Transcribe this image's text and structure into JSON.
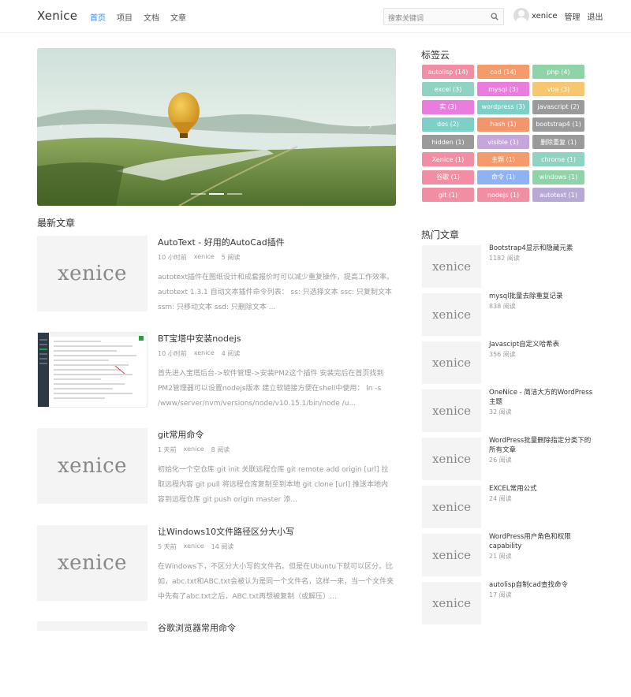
{
  "header": {
    "brand": "Xenice",
    "nav": [
      "首页",
      "项目",
      "文档",
      "文章"
    ],
    "search_placeholder": "搜索关键词",
    "username": "xenice",
    "manage_label": "管理",
    "logout_label": "退出"
  },
  "sections": {
    "latest_title": "最新文章",
    "tags_title": "标签云",
    "hot_title": "热门文章"
  },
  "posts": [
    {
      "title": "AutoText - 好用的AutoCad插件",
      "time": "10 小时前",
      "author": "xenice",
      "reads": "5 阅读",
      "thumb_text": "xenice",
      "excerpt": "autotext插件在图纸设计和成套报价时可以减少重复操作，提高工作效率。 autotext 1.3.1 自动文本插件命令列表： ss: 只选择文本 ssc: 只复制文本 ssm: 只移动文本 ssd: 只删除文本 ..."
    },
    {
      "title": "BT宝塔中安装nodejs",
      "time": "10 小时前",
      "author": "xenice",
      "reads": "4 阅读",
      "thumb_text": "",
      "excerpt": "首先进入宝塔后台->软件管理->安装PM2这个插件 安装完后在首页找到PM2管理器可以设置nodejs版本 建立软链接方便在shell中使用： ln -s /www/server/nvm/versions/node/v10.15.1/bin/node /u..."
    },
    {
      "title": "git常用命令",
      "time": "1 天前",
      "author": "xenice",
      "reads": "8 阅读",
      "thumb_text": "xenice",
      "excerpt": "初始化一个空仓库 git init 关联远程仓库 git remote add origin [url] 拉取远程内容 git pull 将远程仓库复制至到本地 git clone [url] 推送本地内容到远程仓库 git push origin master 添..."
    },
    {
      "title": "让Windows10文件路径区分大小写",
      "time": "5 天前",
      "author": "xenice",
      "reads": "14 阅读",
      "thumb_text": "xenice",
      "excerpt": "在Windows下，不区分大小写的文件名。但是在Ubuntu下就可以区分。比如，abc.txt和ABC.txt会被认为是同一个文件名，这样一来，当一个文件夹中先有了abc.txt之后，ABC.txt再想被复制（或解压）..."
    },
    {
      "title": "谷歌浏览器常用命令",
      "time": "",
      "author": "",
      "reads": "",
      "thumb_text": "",
      "excerpt": ""
    }
  ],
  "tags": [
    {
      "label": "autolisp (14)",
      "color": "#f28ea3"
    },
    {
      "label": "cad (14)",
      "color": "#f59a6a"
    },
    {
      "label": "php (4)",
      "color": "#8fd3a8"
    },
    {
      "label": "excel (3)",
      "color": "#8fd3c3"
    },
    {
      "label": "mysql (3)",
      "color": "#ea7bdf"
    },
    {
      "label": "vba (3)",
      "color": "#f7c66e"
    },
    {
      "label": "实 (3)",
      "color": "#ea7bdf"
    },
    {
      "label": "wordpress (3)",
      "color": "#7dcfc7"
    },
    {
      "label": "javascript (2)",
      "color": "#9a9a9a"
    },
    {
      "label": "dos (2)",
      "color": "#7dcfc7"
    },
    {
      "label": "hash (1)",
      "color": "#f5956b"
    },
    {
      "label": "bootstrap4 (1)",
      "color": "#9a9a9a"
    },
    {
      "label": "hidden (1)",
      "color": "#9a9a9a"
    },
    {
      "label": "visible (1)",
      "color": "#c4a6dd"
    },
    {
      "label": "删除重复 (1)",
      "color": "#9a9a9a"
    },
    {
      "label": "Xenice (1)",
      "color": "#f28ea3"
    },
    {
      "label": "主题 (1)",
      "color": "#f59a6a"
    },
    {
      "label": "chrome (1)",
      "color": "#8fd3c3"
    },
    {
      "label": "谷歌 (1)",
      "color": "#f28ea3"
    },
    {
      "label": "命令 (1)",
      "color": "#8fb2f2"
    },
    {
      "label": "windows (1)",
      "color": "#8fd3a8"
    },
    {
      "label": "git (1)",
      "color": "#f28ea3"
    },
    {
      "label": "nodejs (1)",
      "color": "#f28ea3"
    },
    {
      "label": "autotext (1)",
      "color": "#b8a9d4"
    }
  ],
  "hot": [
    {
      "title": "Bootstrap4显示和隐藏元素",
      "views": "1182 阅读",
      "thumb_text": "xenice"
    },
    {
      "title": "mysql批量去除重复记录",
      "views": "838 阅读",
      "thumb_text": "xenice"
    },
    {
      "title": "Javascipt自定义哈希表",
      "views": "356 阅读",
      "thumb_text": "xenice"
    },
    {
      "title": "OneNice - 简洁大方的WordPress主题",
      "views": "32 阅读",
      "thumb_text": "xenice"
    },
    {
      "title": "WordPress批量删除指定分类下的所有文章",
      "views": "26 阅读",
      "thumb_text": "xenice"
    },
    {
      "title": "EXCEL常用公式",
      "views": "24 阅读",
      "thumb_text": "xenice"
    },
    {
      "title": "WordPress用户角色和权限capability",
      "views": "21 阅读",
      "thumb_text": "xenice"
    },
    {
      "title": "autolisp自制cad查找命令",
      "views": "17 阅读",
      "thumb_text": "xenice"
    }
  ]
}
